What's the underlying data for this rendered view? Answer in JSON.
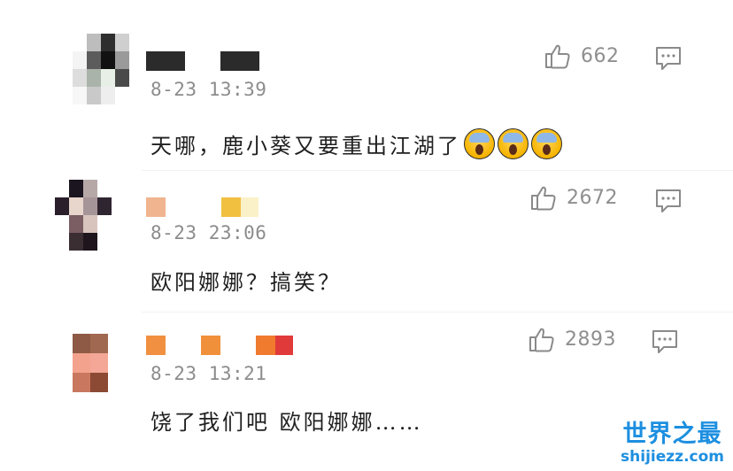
{
  "comments": [
    {
      "time": "8-23 13:39",
      "likes": "662",
      "text": "天哪，鹿小葵又要重出江湖了",
      "emoji_count": 3,
      "avatar_colors": [
        "#ffffff",
        "#bdbdbd",
        "#2e2e2e",
        "#cfcfcf",
        "#f4f4f4",
        "#5c5c5c",
        "#111111",
        "#9a9a9a",
        "#dddddd",
        "#a9b3aa",
        "#e8efe6",
        "#4a4a4a",
        "#f7f7f7",
        "#c9c9c9",
        "#eeeeee",
        "#ffffff"
      ],
      "name_colors": [
        "#2b2b2b",
        "#2b2b2b"
      ]
    },
    {
      "time": "8-23 23:06",
      "likes": "2672",
      "text": "欧阳娜娜？搞笑？",
      "emoji_count": 0,
      "avatar_colors": [
        "#ffffff",
        "#1b1520",
        "#b7a8a8",
        "#ffffff",
        "#2a1f2a",
        "#e8d6cc",
        "#a69598",
        "#2f2530",
        "#ffffff",
        "#7a5e63",
        "#d9c4bd",
        "#ffffff",
        "#ffffff",
        "#3b2e33",
        "#1e161c",
        "#ffffff"
      ],
      "name_colors": [
        "#f0b48f",
        "#f2c040"
      ]
    },
    {
      "time": "8-23 13:21",
      "likes": "2893",
      "text": "饶了我们吧 欧阳娜娜……",
      "emoji_count": 0,
      "avatar_colors": [
        "#8e5a45",
        "#a06850",
        "#f3a28e",
        "#f4a796",
        "#c9785f",
        "#8c4a35"
      ],
      "name_colors": [
        "#f09040",
        "#f0903a",
        "#f07a2e",
        "#e03a3a"
      ]
    }
  ],
  "watermark": {
    "title": "世界之最",
    "url": "shijiezz.com",
    "color": "#1d8fe0"
  },
  "icons": {
    "like": "thumbs-up-icon",
    "reply": "comment-icon"
  }
}
